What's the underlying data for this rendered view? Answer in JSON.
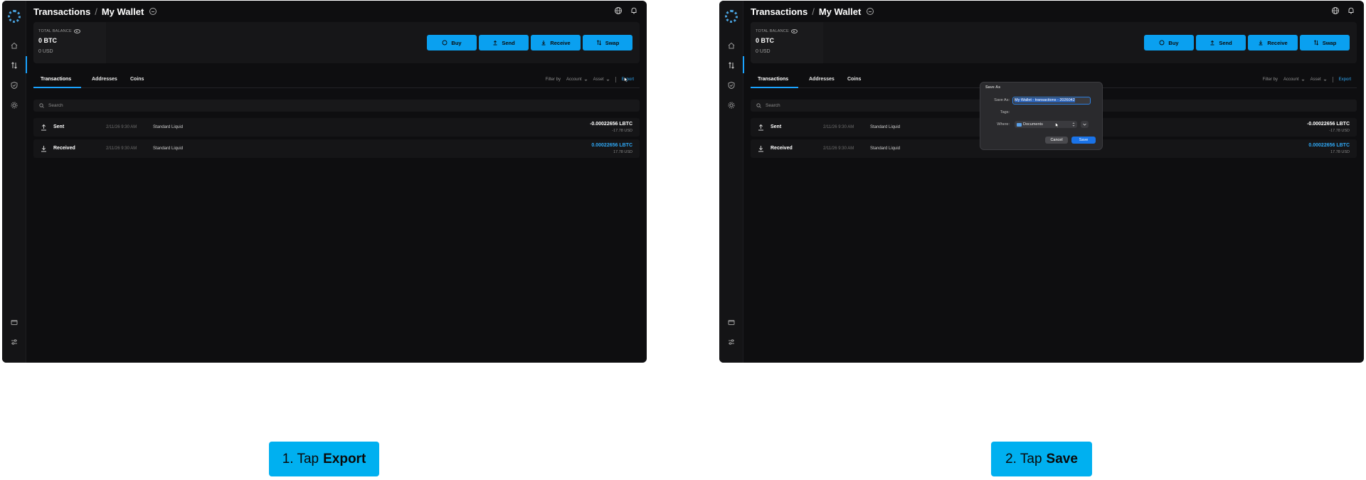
{
  "panels": [
    {
      "breadcrumb": {
        "section": "Transactions",
        "separator": "/",
        "wallet": "My Wallet"
      },
      "balance": {
        "label": "TOTAL BALANCE",
        "btc": "0 BTC",
        "usd": "0 USD"
      },
      "actions": [
        "Buy",
        "Send",
        "Receive",
        "Swap"
      ],
      "tabs": [
        "Transactions",
        "Addresses",
        "Coins"
      ],
      "filters": {
        "filter_by": "Filter by",
        "account": "Account",
        "asset": "Asset",
        "export": "Export"
      },
      "search_placeholder": "Search",
      "transactions": [
        {
          "type": "Sent",
          "date": "2/11/26 9:30 AM",
          "account": "Standard Liquid",
          "amount": "-0.00022656 LBTC",
          "usd": "-17.78 USD"
        },
        {
          "type": "Received",
          "date": "2/11/26 9:30 AM",
          "account": "Standard Liquid",
          "amount": "0.00022656 LBTC",
          "usd": "17.78 USD"
        }
      ]
    },
    {
      "breadcrumb": {
        "section": "Transactions",
        "separator": "/",
        "wallet": "My Wallet"
      },
      "balance": {
        "label": "TOTAL BALANCE",
        "btc": "0 BTC",
        "usd": "0 USD"
      },
      "actions": [
        "Buy",
        "Send",
        "Receive",
        "Swap"
      ],
      "tabs": [
        "Transactions",
        "Addresses",
        "Coins"
      ],
      "filters": {
        "filter_by": "Filter by",
        "account": "Account",
        "asset": "Asset",
        "export": "Export"
      },
      "search_placeholder": "Search",
      "transactions": [
        {
          "type": "Sent",
          "date": "2/11/26 9:30 AM",
          "account": "Standard Liquid",
          "amount": "-0.00022656 LBTC",
          "usd": "-17.78 USD"
        },
        {
          "type": "Received",
          "date": "2/11/26 9:30 AM",
          "account": "Standard Liquid",
          "amount": "0.00022656 LBTC",
          "usd": "17.78 USD"
        }
      ],
      "save_dialog": {
        "title": "Save As",
        "save_as_label": "Save As:",
        "filename": "My Wallet - transactions - 2026042",
        "tags_label": "Tags:",
        "where_label": "Where:",
        "where_value": "Documents",
        "cancel": "Cancel",
        "save": "Save"
      }
    }
  ],
  "steps": [
    {
      "prefix": "1. Tap",
      "action": "Export"
    },
    {
      "prefix": "2. Tap",
      "action": "Save"
    }
  ],
  "colors": {
    "accent": "#0aa0f0",
    "link": "#2fa8f5",
    "step_bg": "#00b0f0",
    "dialog_save": "#1a73e8"
  }
}
